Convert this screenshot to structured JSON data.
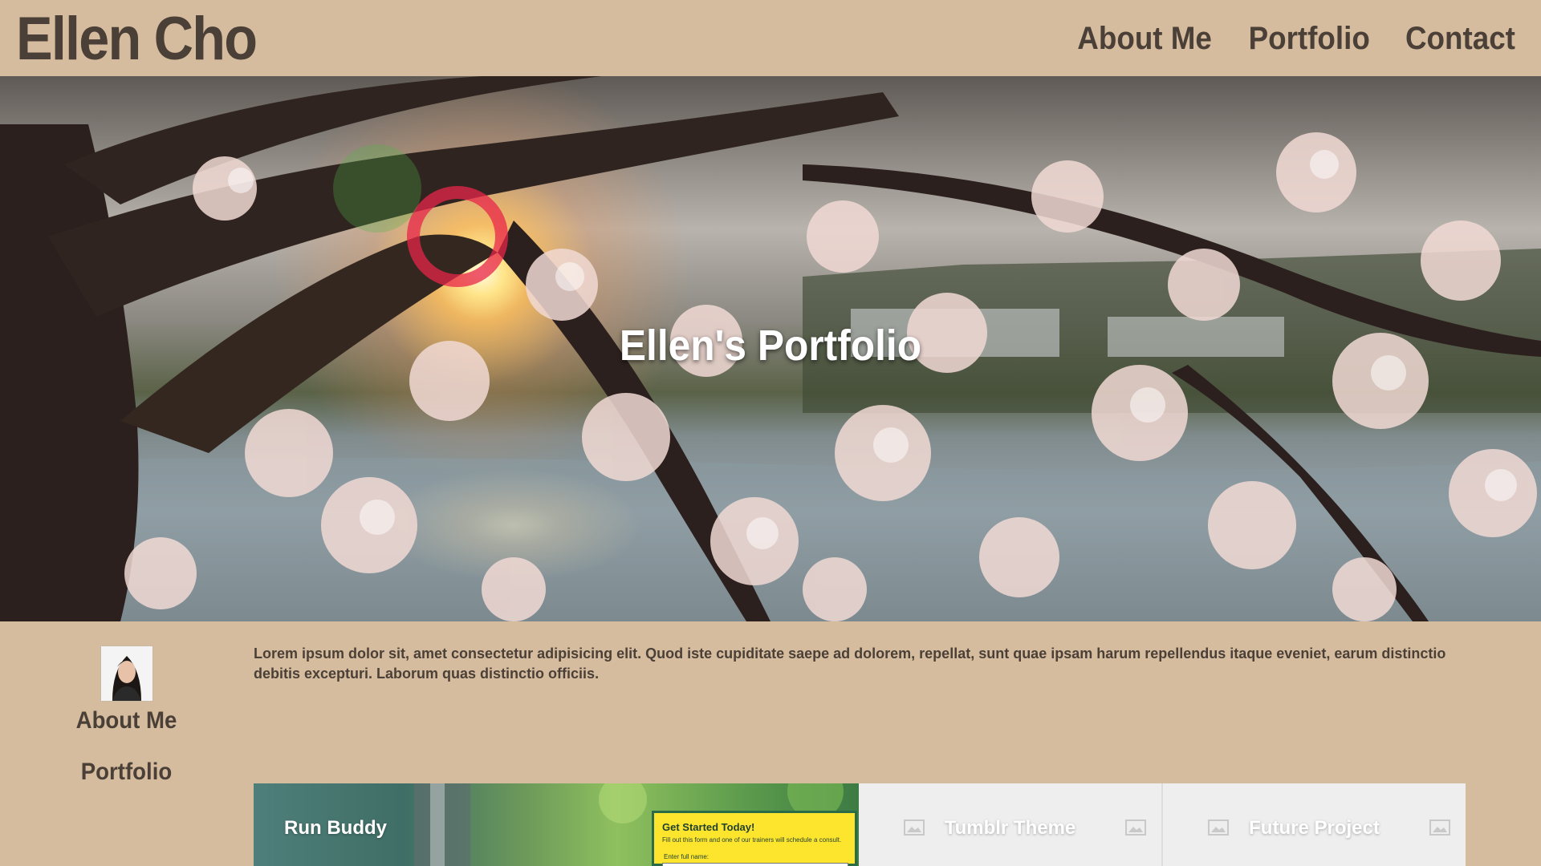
{
  "header": {
    "site_title": "Ellen Cho",
    "nav": [
      "About Me",
      "Portfolio",
      "Contact"
    ]
  },
  "hero": {
    "title": "Ellen's Portfolio"
  },
  "sidebar": {
    "items": [
      "About Me",
      "Portfolio"
    ]
  },
  "about": {
    "text": "Lorem ipsum dolor sit, amet consectetur adipisicing elit. Quod iste cupiditate saepe ad dolorem, repellat, sunt quae ipsam harum repellendus itaque eveniet, earum distinctio debitis excepturi. Laborum quas distinctio officiis."
  },
  "portfolio": {
    "cards": [
      {
        "title": "Run Buddy",
        "form_title": "Get Started Today!",
        "form_sub": "Fill out this form and one of our trainers will schedule a consult.",
        "form_label": "Enter full name:"
      },
      {
        "title": "Tumblr Theme"
      },
      {
        "title": "Future Project"
      }
    ]
  },
  "colors": {
    "background": "#d6bc9e",
    "text": "#4b4037",
    "accent_yellow": "#fde52e"
  }
}
